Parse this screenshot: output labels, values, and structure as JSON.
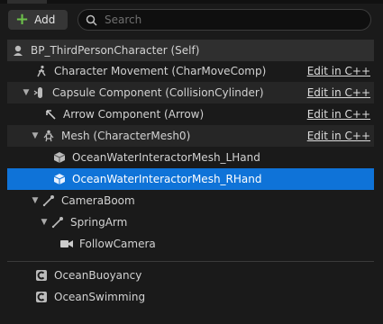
{
  "toolbar": {
    "add_label": "Add",
    "search_placeholder": "Search"
  },
  "tree": {
    "root": {
      "label": "BP_ThirdPersonCharacter (Self)"
    },
    "character_movement": {
      "label": "Character Movement (CharMoveComp)",
      "edit": "Edit in C++"
    },
    "capsule": {
      "label": "Capsule Component (CollisionCylinder)",
      "edit": "Edit in C++"
    },
    "arrow": {
      "label": "Arrow Component (Arrow)",
      "edit": "Edit in C++"
    },
    "mesh": {
      "label": "Mesh (CharacterMesh0)",
      "edit": "Edit in C++"
    },
    "lhand": {
      "label": "OceanWaterInteractorMesh_LHand"
    },
    "rhand": {
      "label": "OceanWaterInteractorMesh_RHand"
    },
    "camera_boom": {
      "label": "CameraBoom"
    },
    "spring_arm": {
      "label": "SpringArm"
    },
    "follow_camera": {
      "label": "FollowCamera"
    }
  },
  "components": {
    "buoyancy": {
      "label": "OceanBuoyancy"
    },
    "swimming": {
      "label": "OceanSwimming"
    }
  }
}
